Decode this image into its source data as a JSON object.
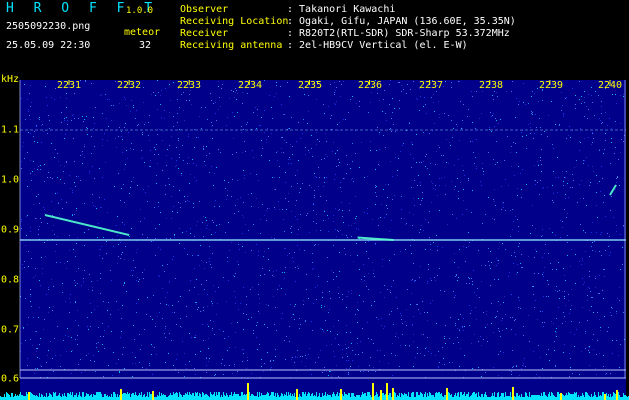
{
  "header": {
    "app_name": "H R O F F T",
    "app_version": "1.0.0",
    "filename": "2505092230.png",
    "meteor_label": "meteor",
    "datetime": "25.05.09 22:30",
    "meteor_count": "32"
  },
  "info": [
    {
      "label": "Observer",
      "value": ": Takanori Kawachi"
    },
    {
      "label": "Receiving Location",
      "value": ": Ogaki, Gifu, JAPAN (136.60E, 35.35N)"
    },
    {
      "label": "Receiver",
      "value": ": R820T2(RTL-SDR) SDR-Sharp 53.372MHz"
    },
    {
      "label": "Receiving antenna",
      "value": ": 2el-HB9CV Vertical (el. E-W)"
    }
  ],
  "axes": {
    "y_unit": "kHz",
    "x_ticks": [
      "2231",
      "2232",
      "2233",
      "2234",
      "2235",
      "2236",
      "2237",
      "2238",
      "2239",
      "2240"
    ],
    "y_ticks": [
      "1.1",
      "1.0",
      "0.9",
      "0.8",
      "0.7",
      "0.6"
    ]
  },
  "colors": {
    "background": "#000000",
    "spectrogram_base": "#00008a",
    "label_yellow": "#ffff00",
    "title_cyan": "#00e5ff",
    "carrier_line": "#8fe3ff",
    "meteor_trace": "#55ffd0",
    "grid_line": "#b8c2ff",
    "activity_bar": "#00e5ff",
    "activity_peak": "#ffff00"
  },
  "chart_data": {
    "type": "heatmap",
    "x": [
      "2231",
      "2232",
      "2233",
      "2234",
      "2235",
      "2236",
      "2237",
      "2238",
      "2239",
      "2240"
    ],
    "ylabel": "kHz",
    "ylim": [
      0.6,
      1.1
    ],
    "carrier_khz": 0.88,
    "reference_line_khz": 1.1,
    "meteor_traces": [
      {
        "start_minute": 2230.6,
        "end_minute": 2232.0,
        "start_khz": 0.93,
        "end_khz": 0.89
      },
      {
        "start_minute": 2235.8,
        "end_minute": 2236.4,
        "start_khz": 0.885,
        "end_khz": 0.88
      },
      {
        "start_minute": 2240.0,
        "end_minute": 2240.1,
        "start_khz": 0.97,
        "end_khz": 0.99
      }
    ]
  }
}
